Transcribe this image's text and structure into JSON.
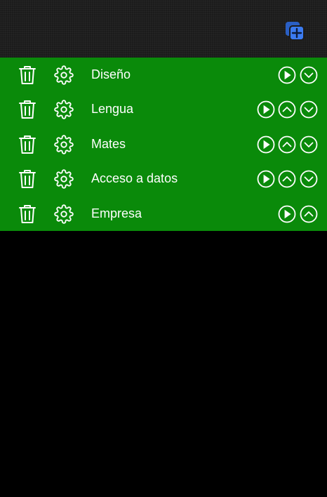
{
  "header": {
    "add_icon": "add-copy-icon"
  },
  "colors": {
    "header_bg": "#1b1b1b",
    "list_bg": "#0a8a0a",
    "accent_blue": "#2f6fdc",
    "icon_white": "#ffffff",
    "page_bg": "#000000"
  },
  "subjects": [
    {
      "label": "Diseño",
      "controls": [
        "play",
        "down"
      ]
    },
    {
      "label": "Lengua",
      "controls": [
        "play",
        "up",
        "down"
      ]
    },
    {
      "label": "Mates",
      "controls": [
        "play",
        "up",
        "down"
      ]
    },
    {
      "label": "Acceso a datos",
      "controls": [
        "play",
        "up",
        "down"
      ]
    },
    {
      "label": "Empresa",
      "controls": [
        "play",
        "up"
      ]
    }
  ]
}
